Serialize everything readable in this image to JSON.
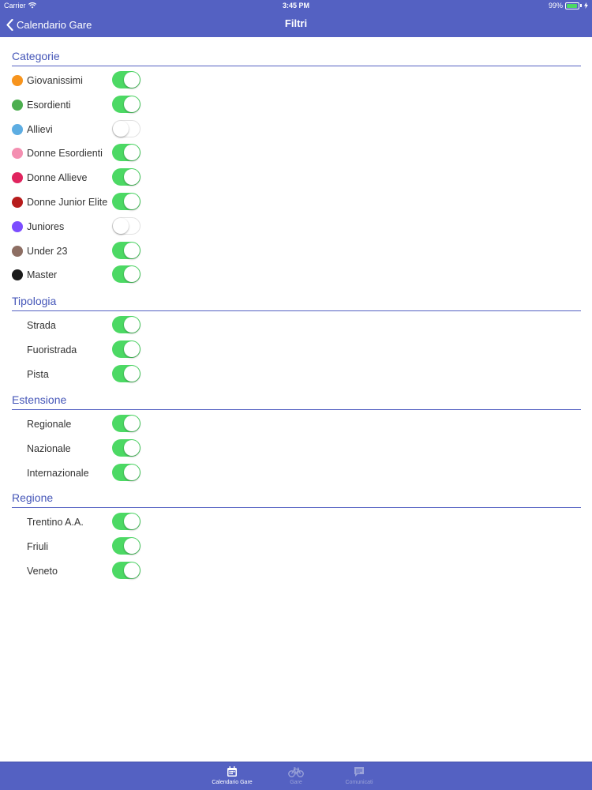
{
  "status_bar": {
    "carrier": "Carrier",
    "time": "3:45 PM",
    "battery": "99%"
  },
  "nav": {
    "back_label": "Calendario Gare",
    "title": "Filtri"
  },
  "colors": {
    "accent": "#5461c2",
    "section_text": "#4556b8",
    "toggle_on": "#4cd964"
  },
  "sections": [
    {
      "title": "Categorie",
      "items": [
        {
          "label": "Giovanissimi",
          "color": "#f7941d",
          "on": true
        },
        {
          "label": "Esordienti",
          "color": "#4cae4f",
          "on": true
        },
        {
          "label": "Allievi",
          "color": "#5dade2",
          "on": false
        },
        {
          "label": "Donne Esordienti",
          "color": "#f48fb1",
          "on": true
        },
        {
          "label": "Donne Allieve",
          "color": "#e0245e",
          "on": true
        },
        {
          "label": "Donne Junior Elite",
          "color": "#b71c1c",
          "on": true
        },
        {
          "label": "Juniores",
          "color": "#7c4dff",
          "on": false
        },
        {
          "label": "Under 23",
          "color": "#8d6e63",
          "on": true
        },
        {
          "label": "Master",
          "color": "#1a1a1a",
          "on": true
        }
      ]
    },
    {
      "title": "Tipologia",
      "items": [
        {
          "label": "Strada",
          "on": true
        },
        {
          "label": "Fuoristrada",
          "on": true
        },
        {
          "label": "Pista",
          "on": true
        }
      ]
    },
    {
      "title": "Estensione",
      "items": [
        {
          "label": "Regionale",
          "on": true
        },
        {
          "label": "Nazionale",
          "on": true
        },
        {
          "label": "Internazionale",
          "on": true
        }
      ]
    },
    {
      "title": "Regione",
      "items": [
        {
          "label": "Trentino A.A.",
          "on": true
        },
        {
          "label": "Friuli",
          "on": true
        },
        {
          "label": "Veneto",
          "on": true
        }
      ]
    }
  ],
  "tabs": [
    {
      "label": "Calendario Gare",
      "icon": "calendar-icon",
      "active": true
    },
    {
      "label": "Gare",
      "icon": "bicycle-icon",
      "active": false
    },
    {
      "label": "Comunicati",
      "icon": "chat-bubble-icon",
      "active": false
    }
  ]
}
